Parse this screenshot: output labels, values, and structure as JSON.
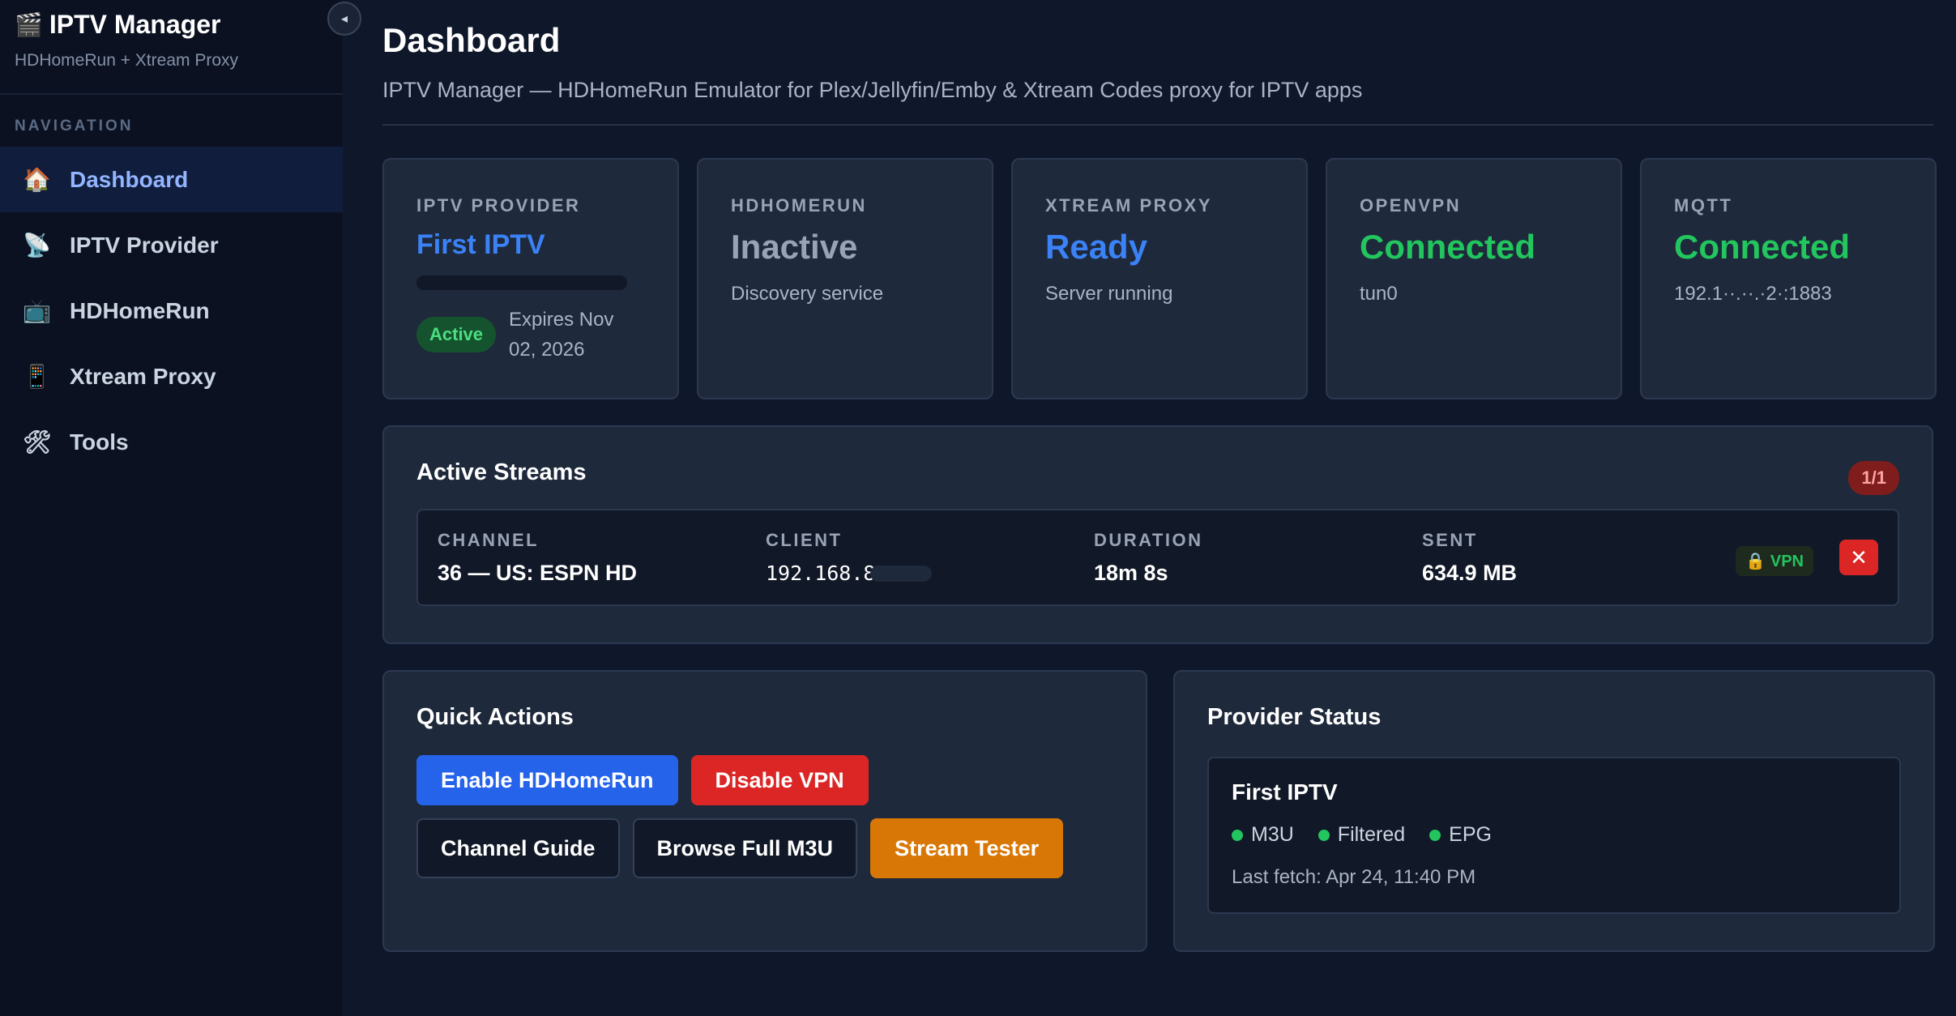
{
  "app": {
    "title": "IPTV Manager",
    "subtitle": "HDHomeRun + Xtream Proxy",
    "logo_emoji": "🎬"
  },
  "sidebar": {
    "collapse_icon": "◂",
    "section_label": "NAVIGATION",
    "items": [
      {
        "icon": "🏠",
        "label": "Dashboard",
        "active": true
      },
      {
        "icon": "📡",
        "label": "IPTV Provider"
      },
      {
        "icon": "📺",
        "label": "HDHomeRun"
      },
      {
        "icon": "📱",
        "label": "Xtream Proxy"
      },
      {
        "icon": "🛠",
        "label": "Tools"
      }
    ]
  },
  "header": {
    "title": "Dashboard",
    "subtitle": "IPTV Manager — HDHomeRun Emulator for Plex/Jellyfin/Emby & Xtream Codes proxy for IPTV apps"
  },
  "cards": {
    "provider": {
      "label": "IPTV PROVIDER",
      "value": "First IPTV",
      "status": "Active",
      "expires": "Expires Nov 02, 2026"
    },
    "hdhomerun": {
      "label": "HDHOMERUN",
      "value": "Inactive",
      "sub": "Discovery service"
    },
    "xtream": {
      "label": "XTREAM PROXY",
      "value": "Ready",
      "sub": "Server running"
    },
    "openvpn": {
      "label": "OPENVPN",
      "value": "Connected",
      "sub": "tun0"
    },
    "mqtt": {
      "label": "MQTT",
      "value": "Connected",
      "sub": "192.1··.··.·2·:1883"
    }
  },
  "streams": {
    "title": "Active Streams",
    "count": "1/1",
    "columns": {
      "channel": "CHANNEL",
      "client": "CLIENT",
      "duration": "DURATION",
      "sent": "SENT"
    },
    "rows": [
      {
        "channel": "36 — US: ESPN HD",
        "client": "192.168.8",
        "duration": "18m 8s",
        "sent": "634.9 MB",
        "vpn": "🔒 VPN",
        "kill": "✕"
      }
    ]
  },
  "quick_actions": {
    "title": "Quick Actions",
    "buttons": [
      "Enable HDHomeRun",
      "Disable VPN",
      "Channel Guide",
      "Browse Full M3U",
      "Stream Tester"
    ]
  },
  "provider_status": {
    "title": "Provider Status",
    "name": "First IPTV",
    "tags": [
      "M3U",
      "Filtered",
      "EPG"
    ],
    "last_fetch": "Last fetch: Apr 24, 11:40 PM"
  },
  "colors": {
    "accent_blue": "#3b82f6",
    "success_green": "#22c55e",
    "danger_red": "#dc2626",
    "warning_orange": "#d97706",
    "background": "#0f172a",
    "card": "#1e293b"
  }
}
